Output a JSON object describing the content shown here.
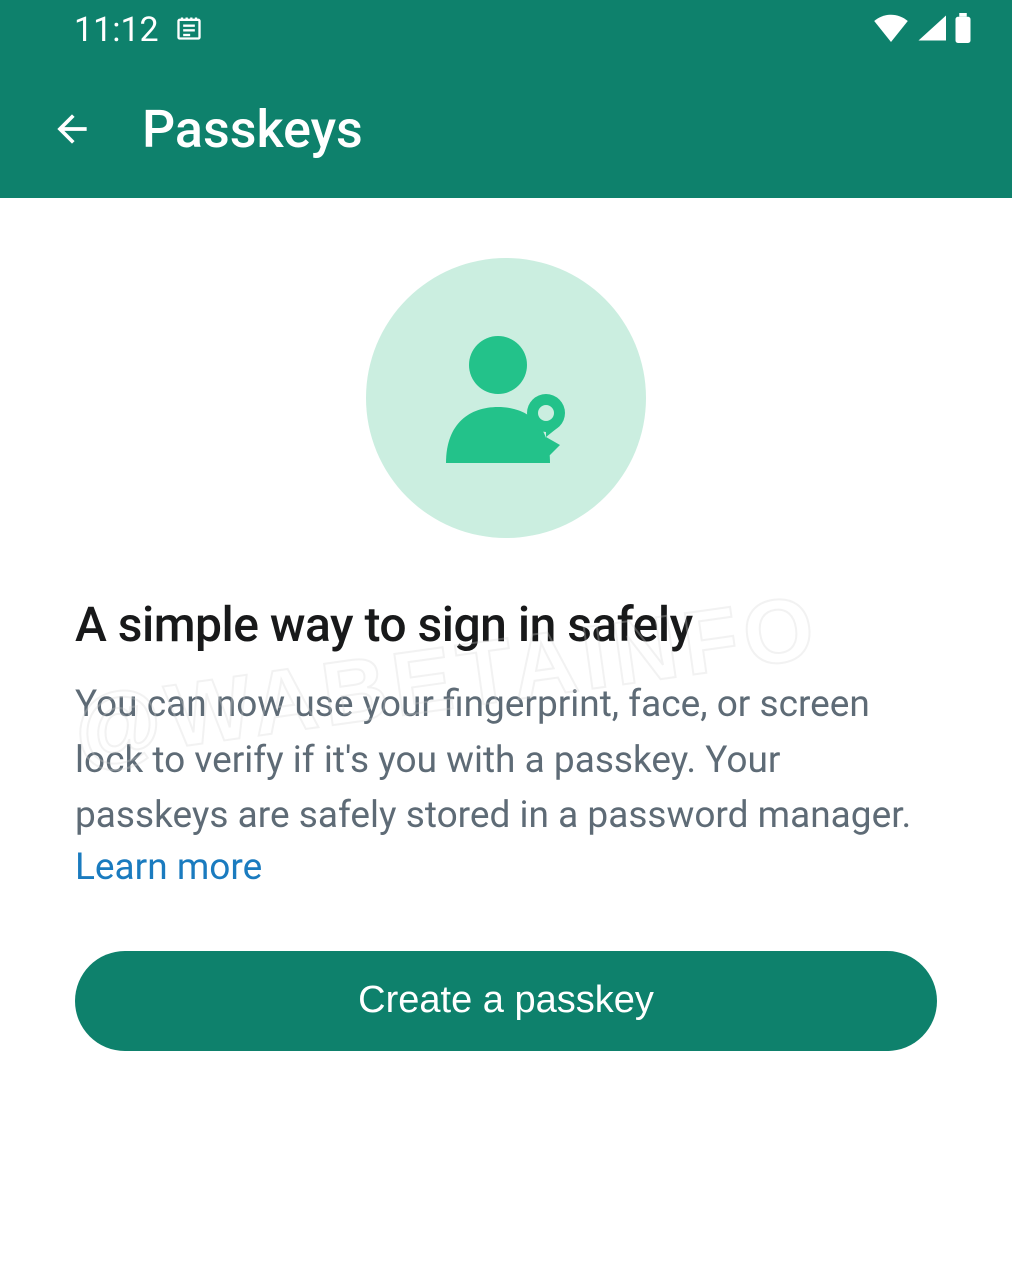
{
  "status": {
    "time": "11:12"
  },
  "appbar": {
    "title": "Passkeys"
  },
  "main": {
    "heading": "A simple way to sign in safely",
    "body": "You can now use your fingerprint, face, or screen lock to verify if it's you with a passkey. Your passkeys are safely stored in a password manager.",
    "learn_more": "Learn more",
    "cta": "Create a passkey"
  },
  "watermark": "@WABETAINFO",
  "colors": {
    "brand": "#0e816c",
    "accent": "#23c28a",
    "circle_bg": "#cbeee0",
    "text_dark": "#18191a",
    "text_muted": "#5e6b76",
    "link": "#1a7bbf"
  }
}
